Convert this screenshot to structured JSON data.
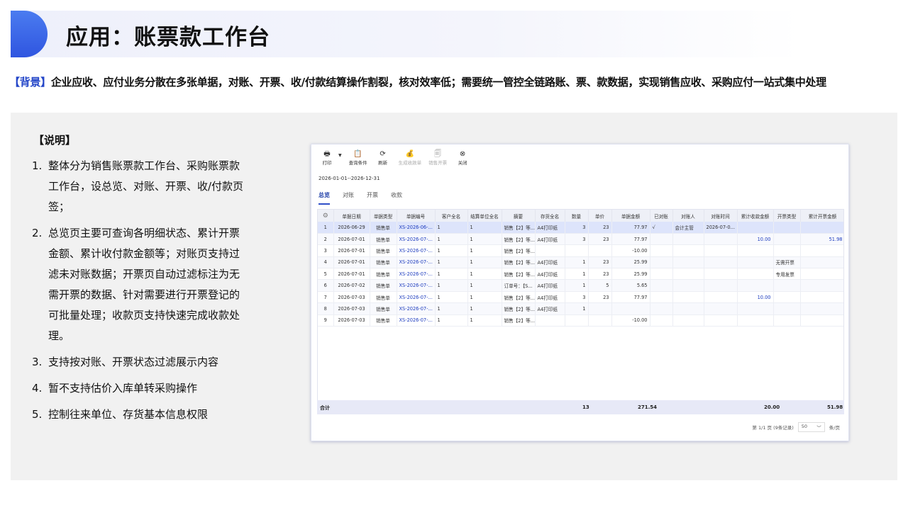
{
  "title": "应用：账票款工作台",
  "background": {
    "tag": "【背景】",
    "text": "企业应收、应付业务分散在多张单据，对账、开票、收/付款结算操作割裂，核对效率低；需要统一管控全链路账、票、款数据，实现销售应收、采购应付一站式集中处理"
  },
  "notes": {
    "title": "【说明】",
    "items": [
      {
        "num": "1.",
        "text": "整体分为销售账票款工作台、采购账票款工作台，设总览、对账、开票、收/付款页签；"
      },
      {
        "num": "2.",
        "text": "总览页主要可查询各明细状态、累计开票金额、累计收付款金额等；对账页支持过滤未对账数据；开票页自动过滤标注为无需开票的数据、针对需要进行开票登记的可批量处理；收款页支持快速完成收款处理。"
      },
      {
        "num": "3.",
        "text": "支持按对账、开票状态过滤展示内容"
      },
      {
        "num": "4.",
        "text": "暂不支持估价入库单转采购操作"
      },
      {
        "num": "5.",
        "text": "控制往来单位、存货基本信息权限"
      }
    ]
  },
  "screenshot": {
    "toolbar": [
      {
        "label": "打印",
        "icon": "printer-icon",
        "glyph": "🖶",
        "disabled": false
      },
      {
        "label": "查询条件",
        "icon": "clipboard-icon",
        "glyph": "📋",
        "disabled": false
      },
      {
        "label": "刷新",
        "icon": "refresh-icon",
        "glyph": "⟳",
        "disabled": false
      },
      {
        "label": "生成收款单",
        "icon": "money-icon",
        "glyph": "💰",
        "disabled": true
      },
      {
        "label": "销售开票",
        "icon": "invoice-icon",
        "glyph": "🗐",
        "disabled": true
      },
      {
        "label": "关闭",
        "icon": "close-icon",
        "glyph": "⊗",
        "disabled": false
      }
    ],
    "date_range": "2026-01-01--2026-12-31",
    "tabs": [
      "总览",
      "对账",
      "开票",
      "收款"
    ],
    "columns": [
      "",
      "单据日期",
      "单据类型",
      "单据编号",
      "客户全名",
      "结算单位全名",
      "摘要",
      "存货全名",
      "数量",
      "单价",
      "单据金额",
      "已对账",
      "对账人",
      "对账时间",
      "累计收款金额",
      "开票类型",
      "累计开票金额"
    ],
    "rows": [
      [
        "1",
        "2026-06-29",
        "销售单",
        "XS-2026-06-...",
        "1",
        "1",
        "销售【2】等...",
        "A4打印纸",
        "3",
        "23",
        "77.97",
        "√",
        "会计主管",
        "2026-07-0...",
        "",
        "",
        ""
      ],
      [
        "2",
        "2026-07-01",
        "销售单",
        "XS-2026-07-...",
        "1",
        "1",
        "销售【2】等...",
        "A4打印纸",
        "3",
        "23",
        "77.97",
        "",
        "",
        "",
        "10.00",
        "",
        "51.98"
      ],
      [
        "3",
        "2026-07-01",
        "销售单",
        "XS-2026-07-...",
        "1",
        "1",
        "销售【2】等...",
        "",
        "",
        "",
        "-10.00",
        "",
        "",
        "",
        "",
        "",
        ""
      ],
      [
        "4",
        "2026-07-01",
        "销售单",
        "XS-2026-07-...",
        "1",
        "1",
        "销售【2】等...",
        "A4打印纸",
        "1",
        "23",
        "25.99",
        "",
        "",
        "",
        "",
        "无需开票",
        ""
      ],
      [
        "5",
        "2026-07-01",
        "销售单",
        "XS-2026-07-...",
        "1",
        "1",
        "销售【2】等...",
        "A4打印纸",
        "1",
        "23",
        "25.99",
        "",
        "",
        "",
        "",
        "专用发票",
        ""
      ],
      [
        "6",
        "2026-07-02",
        "销售单",
        "XS-2026-07-...",
        "1",
        "1",
        "订单号：【S...",
        "A4打印纸",
        "1",
        "5",
        "5.65",
        "",
        "",
        "",
        "",
        "",
        ""
      ],
      [
        "7",
        "2026-07-03",
        "销售单",
        "XS-2026-07-...",
        "1",
        "1",
        "销售【2】等...",
        "A4打印纸",
        "3",
        "23",
        "77.97",
        "",
        "",
        "",
        "10.00",
        "",
        ""
      ],
      [
        "8",
        "2026-07-03",
        "销售单",
        "XS-2026-07-...",
        "1",
        "1",
        "销售【2】等...",
        "A4打印纸",
        "1",
        "",
        "",
        "",
        "",
        "",
        "",
        "",
        ""
      ],
      [
        "9",
        "2026-07-03",
        "销售单",
        "XS-2026-07-...",
        "1",
        "1",
        "销售【2】等...",
        "",
        "",
        "",
        "-10.00",
        "",
        "",
        "",
        "",
        "",
        ""
      ]
    ],
    "summary": {
      "label": "合计",
      "qty": "13",
      "amount": "271.54",
      "received": "20.00",
      "invoiced": "51.98"
    },
    "pager": {
      "info": "第 1/1 页 (9条记录)",
      "size": "50",
      "unit": "条/页"
    }
  },
  "colors": {
    "accent": "#2f55e0",
    "tag": "#2446c8",
    "link": "#1d3cbf"
  }
}
